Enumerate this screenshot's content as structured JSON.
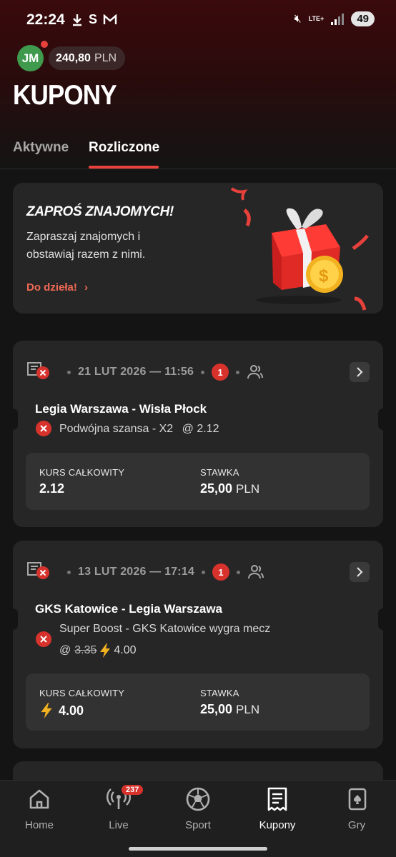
{
  "status_bar": {
    "time": "22:24",
    "battery": "49",
    "network": "LTE+"
  },
  "account": {
    "initials": "JM",
    "balance": "240,80",
    "currency": "PLN"
  },
  "page_title": "KUPONY",
  "tabs": [
    {
      "label": "Aktywne",
      "active": false
    },
    {
      "label": "Rozliczone",
      "active": true
    }
  ],
  "promo": {
    "title": "ZAPROŚ ZNAJOMYCH!",
    "text": "Zapraszaj znajomych i obstawiaj razem z nimi.",
    "link": "Do dzieła!",
    "link_chevron": "›"
  },
  "bets": [
    {
      "date": "21 LUT 2026 — 11:56",
      "count": "1",
      "match": "Legia Warszawa - Wisła Płock",
      "selection": "Podwójna szansa - X2",
      "odds": "@ 2.12",
      "total_odds_label": "KURS CAŁKOWITY",
      "total_odds": "2.12",
      "stake_label": "STAWKA",
      "stake": "25,00",
      "stake_currency": "PLN"
    },
    {
      "date": "13 LUT 2026 — 17:14",
      "count": "1",
      "match": "GKS Katowice - Legia Warszawa",
      "selection": "Super Boost - GKS Katowice wygra mecz",
      "odds_prefix": "@",
      "odds_old": "3.35",
      "odds_new": "4.00",
      "total_odds_label": "KURS CAŁKOWITY",
      "total_odds": "4.00",
      "stake_label": "STAWKA",
      "stake": "25,00",
      "stake_currency": "PLN"
    }
  ],
  "bottom_nav": [
    {
      "label": "Home",
      "icon": "home-icon",
      "active": false
    },
    {
      "label": "Live",
      "icon": "live-icon",
      "badge": "237",
      "active": false
    },
    {
      "label": "Sport",
      "icon": "soccer-ball-icon",
      "active": false
    },
    {
      "label": "Kupony",
      "icon": "coupon-icon",
      "active": true
    },
    {
      "label": "Gry",
      "icon": "cards-icon",
      "active": false
    }
  ],
  "colors": {
    "accent": "#e8413b",
    "badge": "#d7322c",
    "card": "#262626",
    "background": "#141414"
  }
}
